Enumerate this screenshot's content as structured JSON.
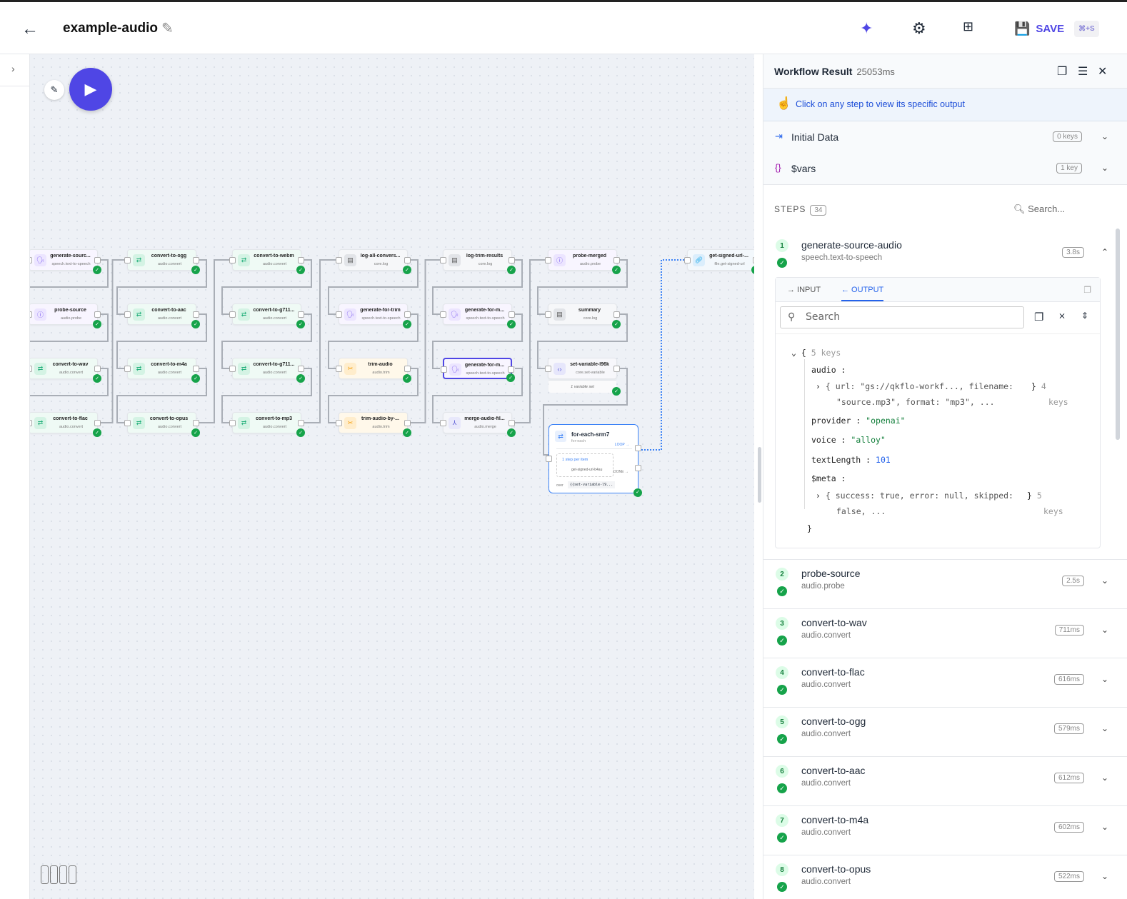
{
  "header": {
    "title": "example-audio",
    "save_label": "SAVE",
    "save_shortcut": "⌘+S",
    "icons": [
      "arrow-left-icon",
      "pencil-icon",
      "sparkles-icon",
      "gear-icon",
      "hierarchy-icon",
      "floppy-disk-icon"
    ]
  },
  "canvas": {
    "columns": [
      [
        {
          "name": "generate-sourc...",
          "type": "speech.text-to-speech",
          "kind": "speech"
        },
        {
          "name": "probe-source",
          "type": "audio.probe",
          "kind": "probe"
        },
        {
          "name": "convert-to-wav",
          "type": "audio.convert",
          "kind": "convert"
        },
        {
          "name": "convert-to-flac",
          "type": "audio.convert",
          "kind": "convert"
        }
      ],
      [
        {
          "name": "convert-to-ogg",
          "type": "audio.convert",
          "kind": "convert"
        },
        {
          "name": "convert-to-aac",
          "type": "audio.convert",
          "kind": "convert"
        },
        {
          "name": "convert-to-m4a",
          "type": "audio.convert",
          "kind": "convert"
        },
        {
          "name": "convert-to-opus",
          "type": "audio.convert",
          "kind": "convert"
        }
      ],
      [
        {
          "name": "convert-to-webm",
          "type": "audio.convert",
          "kind": "convert"
        },
        {
          "name": "convert-to-g711...",
          "type": "audio.convert",
          "kind": "convert"
        },
        {
          "name": "convert-to-g711...",
          "type": "audio.convert",
          "kind": "convert"
        },
        {
          "name": "convert-to-mp3",
          "type": "audio.convert",
          "kind": "convert"
        }
      ],
      [
        {
          "name": "log-all-convers...",
          "type": "core.log",
          "kind": "log"
        },
        {
          "name": "generate-for-trim",
          "type": "speech.text-to-speech",
          "kind": "speech"
        },
        {
          "name": "trim-audio",
          "type": "audio.trim",
          "kind": "trim"
        },
        {
          "name": "trim-audio-by-...",
          "type": "audio.trim",
          "kind": "trim"
        }
      ],
      [
        {
          "name": "log-trim-results",
          "type": "core.log",
          "kind": "log"
        },
        {
          "name": "generate-for-m...",
          "type": "speech.text-to-speech",
          "kind": "speech"
        },
        {
          "name": "generate-for-m...",
          "type": "speech.text-to-speech",
          "kind": "speech",
          "selected": true
        },
        {
          "name": "merge-audio-fil...",
          "type": "audio.merge",
          "kind": "merge"
        }
      ],
      [
        {
          "name": "probe-merged",
          "type": "audio.probe",
          "kind": "probe"
        },
        {
          "name": "summary",
          "type": "core.log",
          "kind": "log"
        },
        {
          "name": "set-variable-l96k",
          "type": "core.set-variable",
          "kind": "setvar",
          "note": "1 variable set"
        }
      ]
    ],
    "signed_url_node": {
      "name": "get-signed-url-...",
      "type": "file.get-signed-url",
      "kind": "link"
    },
    "foreach": {
      "name": "for-each-srm7",
      "type": "for-each",
      "loop_label": "LOOP →",
      "done_label": "DONE →",
      "inner_label": "1 step per item",
      "inner_step": "get-signed-url-b4au",
      "over_label": "over",
      "over_value": "{{set-variable-l9..."
    }
  },
  "panel": {
    "title": "Workflow Result",
    "duration": "25053ms",
    "hint": "Click on any step to view its specific output",
    "initial_data": {
      "label": "Initial Data",
      "badge": "0 keys"
    },
    "vars": {
      "label": "$vars",
      "badge": "1 key"
    },
    "steps_label": "STEPS",
    "steps_count": "34",
    "search_placeholder": "Search...",
    "tabs": {
      "input": "→ INPUT",
      "output": "← OUTPUT"
    },
    "output_search": "Search",
    "json_view": {
      "root_keys": "5 keys",
      "audio_key": "audio",
      "audio_preview_1": "{ url: \"gs://qkflo-workf..., filename:",
      "audio_preview_2": "\"source.mp3\", format: \"mp3\", ...",
      "audio_count": "4",
      "audio_keys": "keys",
      "provider_key": "provider",
      "provider_val": "\"openai\"",
      "voice_key": "voice",
      "voice_val": "\"alloy\"",
      "textlength_key": "textLength",
      "textlength_val": "101",
      "meta_key": "$meta",
      "meta_preview_1": "{ success: true, error: null, skipped:",
      "meta_preview_2": "false, ...",
      "meta_count": "5",
      "meta_keys": "keys"
    },
    "steps": [
      {
        "num": "1",
        "name": "generate-source-audio",
        "type": "speech.text-to-speech",
        "time": "3.8s"
      },
      {
        "num": "2",
        "name": "probe-source",
        "type": "audio.probe",
        "time": "2.5s"
      },
      {
        "num": "3",
        "name": "convert-to-wav",
        "type": "audio.convert",
        "time": "711ms"
      },
      {
        "num": "4",
        "name": "convert-to-flac",
        "type": "audio.convert",
        "time": "616ms"
      },
      {
        "num": "5",
        "name": "convert-to-ogg",
        "type": "audio.convert",
        "time": "579ms"
      },
      {
        "num": "6",
        "name": "convert-to-aac",
        "type": "audio.convert",
        "time": "612ms"
      },
      {
        "num": "7",
        "name": "convert-to-m4a",
        "type": "audio.convert",
        "time": "602ms"
      },
      {
        "num": "8",
        "name": "convert-to-opus",
        "type": "audio.convert",
        "time": "522ms"
      }
    ]
  },
  "colors": {
    "accent": "#4f46e5",
    "success": "#16a34a",
    "link": "#2563eb"
  }
}
